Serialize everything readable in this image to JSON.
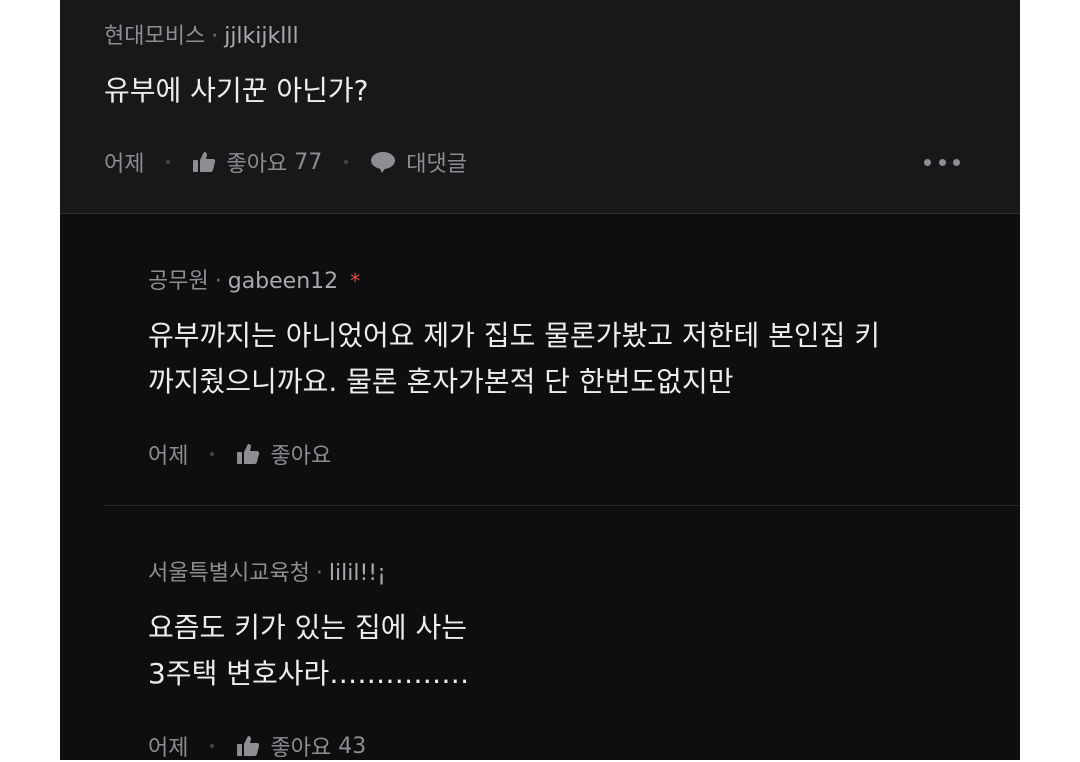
{
  "comments": [
    {
      "nickname": "현대모비스",
      "separator": "·",
      "user_id": "jjlkijklll",
      "text_lines": [
        "유부에 사기꾼 아닌가?"
      ],
      "time": "어제",
      "like_label": "좋아요",
      "like_count": "77",
      "reply_label": "대댓글"
    },
    {
      "nickname": "공무원",
      "separator": "·",
      "user_id": "gabeen12",
      "badge": "*",
      "text_lines": [
        "유부까지는 아니었어요 제가 집도 물론가봤고 저한테 본인집 키",
        "까지줬으니까요. 물론 혼자가본적 단 한번도없지만"
      ],
      "time": "어제",
      "like_label": "좋아요"
    },
    {
      "nickname": "서울특별시교육청",
      "separator": "·",
      "user_id": "lilil!!¡",
      "text_lines": [
        "요즘도 키가 있는 집에 사는",
        "3주택 변호사라……………"
      ],
      "time": "어제",
      "like_label": "좋아요",
      "like_count": "43"
    }
  ],
  "colors": {
    "background": "#0e0e10",
    "top_comment_bg": "#18181a",
    "text": "#ededf0",
    "meta": "#8d8d92",
    "badge": "#e04b3c"
  },
  "icons": {
    "like": "thumbs-up-icon",
    "reply": "speech-bubble-icon",
    "more": "more-dots-icon"
  }
}
